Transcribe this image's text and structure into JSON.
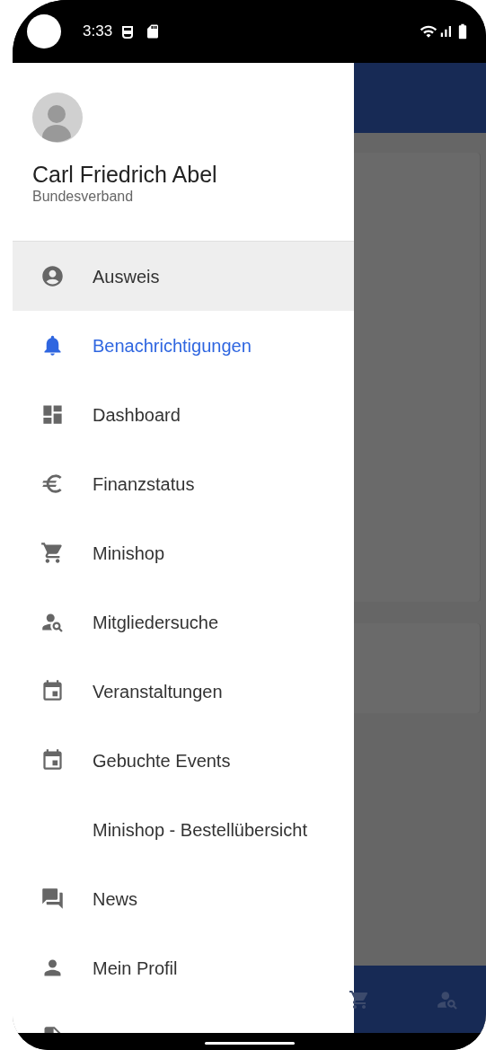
{
  "status_bar": {
    "time": "3:33"
  },
  "drawer": {
    "user": {
      "name": "Carl Friedrich Abel",
      "organization": "Bundesverband"
    },
    "items": [
      {
        "label": "Ausweis",
        "highlighted": true,
        "selected": false
      },
      {
        "label": "Benachrichtigungen",
        "highlighted": false,
        "selected": true
      },
      {
        "label": "Dashboard",
        "highlighted": false,
        "selected": false
      },
      {
        "label": "Finanzstatus",
        "highlighted": false,
        "selected": false
      },
      {
        "label": "Minishop",
        "highlighted": false,
        "selected": false
      },
      {
        "label": "Mitgliedersuche",
        "highlighted": false,
        "selected": false
      },
      {
        "label": "Veranstaltungen",
        "highlighted": false,
        "selected": false
      },
      {
        "label": "Gebuchte Events",
        "highlighted": false,
        "selected": false
      },
      {
        "label": "Minishop - Bestellübersicht",
        "highlighted": false,
        "selected": false
      },
      {
        "label": "News",
        "highlighted": false,
        "selected": false
      },
      {
        "label": "Mein Profil",
        "highlighted": false,
        "selected": false
      },
      {
        "highlighted": false,
        "selected": false
      }
    ]
  }
}
